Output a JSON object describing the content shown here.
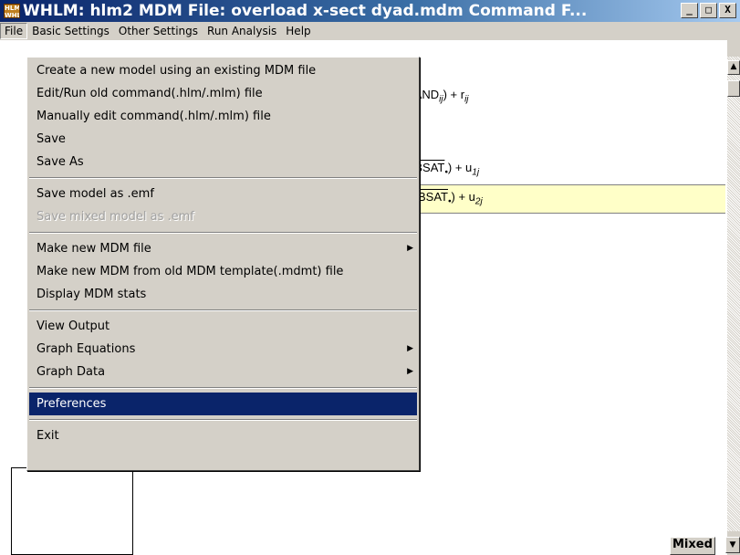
{
  "window": {
    "app_icon_text": "HLM WHLM",
    "title": "WHLM: hlm2 MDM File: overload x-sect dyad.mdm   Command F...",
    "minimize_label": "_",
    "maximize_label": "□",
    "close_label": "X"
  },
  "menubar": {
    "items": [
      "File",
      "Basic Settings",
      "Other Settings",
      "Run Analysis",
      "Help"
    ],
    "active": "File"
  },
  "file_menu": {
    "items": [
      {
        "label": "Create a new model using an existing MDM file"
      },
      {
        "label": "Edit/Run old command(.hlm/.mlm) file"
      },
      {
        "label": "Manually edit command(.hlm/.mlm) file"
      },
      {
        "label": "Save"
      },
      {
        "label": "Save As"
      },
      {
        "label": "Save model as .emf"
      },
      {
        "label": "Save mixed model as .emf",
        "disabled": true
      },
      {
        "label": "Make new MDM file",
        "submenu": true
      },
      {
        "label": "Make new MDM from old MDM template(.mdmt) file"
      },
      {
        "label": "Display MDM stats"
      },
      {
        "label": "View Output"
      },
      {
        "label": "Graph Equations",
        "submenu": true
      },
      {
        "label": "Graph Data",
        "submenu": true
      },
      {
        "label": "Preferences",
        "selected": true
      },
      {
        "label": "Exit"
      }
    ],
    "submenu_arrow": "▶"
  },
  "equations": {
    "line1": {
      "pre": "BAND",
      "sub1": "ij",
      "post": ") + r",
      "sub2": "ij"
    },
    "line2": {
      "pre": "DBSAT",
      "sub1": "•",
      "post": ") + u",
      "sub2": "1j"
    },
    "line3": {
      "pre": "BSAT",
      "sub1": "•",
      "post": ") + u",
      "sub2": "2j"
    }
  },
  "status": {
    "mode_label": "Mixed",
    "dropdown_arrow": "▼"
  },
  "scrollbar": {
    "up_arrow": "▲"
  }
}
